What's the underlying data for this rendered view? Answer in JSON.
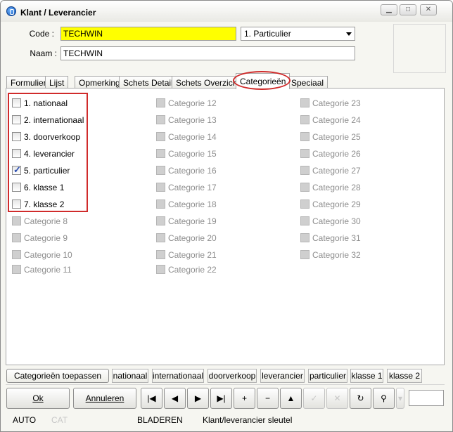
{
  "window": {
    "title": "Klant / Leverancier"
  },
  "form": {
    "code_label": "Code :",
    "code_value": "TECHWIN",
    "type_value": "1.  Particulier",
    "name_label": "Naam :",
    "name_value": "TECHWIN"
  },
  "tabs": [
    {
      "label": "Formulier"
    },
    {
      "label": "Lijst"
    },
    {
      "label": "Opmerking"
    },
    {
      "label": "Schets Detail"
    },
    {
      "label": "Schets Overzicht"
    },
    {
      "label": "Categorieën",
      "active": true
    },
    {
      "label": "Speciaal"
    }
  ],
  "categories": [
    {
      "label": "1. nationaal",
      "checked": false,
      "enabled": true
    },
    {
      "label": "2. internationaal",
      "checked": false,
      "enabled": true
    },
    {
      "label": "3. doorverkoop",
      "checked": false,
      "enabled": true
    },
    {
      "label": "4. leverancier",
      "checked": false,
      "enabled": true
    },
    {
      "label": "5. particulier",
      "checked": true,
      "enabled": true
    },
    {
      "label": "6. klasse 1",
      "checked": false,
      "enabled": true
    },
    {
      "label": "7. klasse 2",
      "checked": false,
      "enabled": true
    },
    {
      "label": "Categorie 8",
      "checked": false,
      "enabled": false
    },
    {
      "label": "Categorie 9",
      "checked": false,
      "enabled": false
    },
    {
      "label": "Categorie 10",
      "checked": false,
      "enabled": false
    },
    {
      "label": "Categorie 11",
      "checked": false,
      "enabled": false
    },
    {
      "label": "Categorie 12",
      "checked": false,
      "enabled": false
    },
    {
      "label": "Categorie 13",
      "checked": false,
      "enabled": false
    },
    {
      "label": "Categorie 14",
      "checked": false,
      "enabled": false
    },
    {
      "label": "Categorie 15",
      "checked": false,
      "enabled": false
    },
    {
      "label": "Categorie 16",
      "checked": false,
      "enabled": false
    },
    {
      "label": "Categorie 17",
      "checked": false,
      "enabled": false
    },
    {
      "label": "Categorie 18",
      "checked": false,
      "enabled": false
    },
    {
      "label": "Categorie 19",
      "checked": false,
      "enabled": false
    },
    {
      "label": "Categorie 20",
      "checked": false,
      "enabled": false
    },
    {
      "label": "Categorie 21",
      "checked": false,
      "enabled": false
    },
    {
      "label": "Categorie 22",
      "checked": false,
      "enabled": false
    },
    {
      "label": "Categorie 23",
      "checked": false,
      "enabled": false
    },
    {
      "label": "Categorie 24",
      "checked": false,
      "enabled": false
    },
    {
      "label": "Categorie 25",
      "checked": false,
      "enabled": false
    },
    {
      "label": "Categorie 26",
      "checked": false,
      "enabled": false
    },
    {
      "label": "Categorie 27",
      "checked": false,
      "enabled": false
    },
    {
      "label": "Categorie 28",
      "checked": false,
      "enabled": false
    },
    {
      "label": "Categorie 29",
      "checked": false,
      "enabled": false
    },
    {
      "label": "Categorie 30",
      "checked": false,
      "enabled": false
    },
    {
      "label": "Categorie 31",
      "checked": false,
      "enabled": false
    },
    {
      "label": "Categorie 32",
      "checked": false,
      "enabled": false
    }
  ],
  "filter_bar": {
    "apply_label": "Categorieën toepassen",
    "items": [
      "nationaal",
      "internationaal",
      "doorverkoop",
      "leverancier",
      "particulier",
      "klasse 1",
      "klasse 2"
    ]
  },
  "actions": {
    "ok_label": "Ok",
    "cancel_label": "Annuleren",
    "nav": [
      {
        "icon": "first-record-icon",
        "glyph": "|◀",
        "enabled": true
      },
      {
        "icon": "previous-record-icon",
        "glyph": "◀",
        "enabled": true
      },
      {
        "icon": "next-record-icon",
        "glyph": "▶",
        "enabled": true
      },
      {
        "icon": "last-record-icon",
        "glyph": "▶|",
        "enabled": true
      },
      {
        "icon": "add-record-icon",
        "glyph": "+",
        "enabled": true
      },
      {
        "icon": "delete-record-icon",
        "glyph": "−",
        "enabled": true
      },
      {
        "icon": "move-up-icon",
        "glyph": "▲",
        "enabled": true
      },
      {
        "icon": "confirm-icon",
        "glyph": "✓",
        "enabled": false
      },
      {
        "icon": "cancel-edit-icon",
        "glyph": "✕",
        "enabled": false
      },
      {
        "icon": "refresh-icon",
        "glyph": "↻",
        "enabled": true
      },
      {
        "icon": "binoculars-icon",
        "glyph": "⚲",
        "enabled": true
      }
    ]
  },
  "status": {
    "mode": "AUTO",
    "cat": "CAT",
    "state": "BLADEREN",
    "key": "Klant/leverancier sleutel"
  }
}
